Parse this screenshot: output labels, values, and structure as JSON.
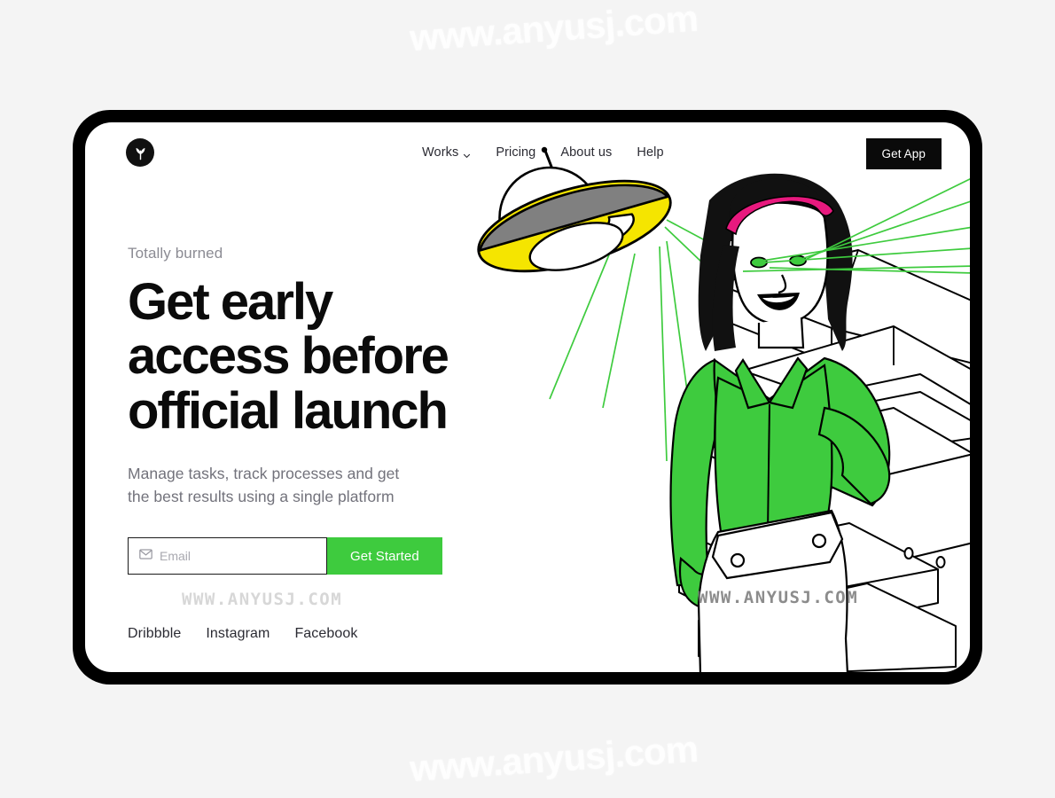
{
  "page": {
    "background_color": "#f4f4f4",
    "frame_color": "#000000",
    "screen_color": "#ffffff"
  },
  "watermarks": {
    "large": "www.anyusj.com",
    "pixel": "WWW.ANYUSJ.COM"
  },
  "header": {
    "logo_icon": "sprout-logo-icon",
    "nav": [
      {
        "label": "Works",
        "has_dropdown": true,
        "icon": "chevron-down-icon"
      },
      {
        "label": "Pricing",
        "has_dropdown": false
      },
      {
        "label": "About us",
        "has_dropdown": false
      },
      {
        "label": "Help",
        "has_dropdown": false
      }
    ],
    "cta": {
      "label": "Get App",
      "background": "#0a0a0a",
      "color": "#ffffff"
    }
  },
  "hero": {
    "eyebrow": "Totally burned",
    "headline_lines": [
      "Get early",
      "access before",
      "official launch"
    ],
    "headline": "Get early access before official launch",
    "subhead_lines": [
      "Manage tasks, track processes and get",
      "the best results using a single platform"
    ],
    "form": {
      "email_icon": "envelope-icon",
      "email_value": "",
      "email_placeholder": "Email",
      "submit_label": "Get Started",
      "submit_color": "#3ECB3E"
    }
  },
  "socials": [
    {
      "label": "Dribbble"
    },
    {
      "label": "Instagram"
    },
    {
      "label": "Facebook"
    }
  ],
  "illustration": {
    "name": "ufo-abducting-woman-at-printer",
    "ufo": {
      "body_color": "#F5E500",
      "top_band_color": "#808080",
      "dome_color": "#ffffff",
      "outline_color": "#000000",
      "beam_color": "#3ECB3E"
    },
    "character": {
      "hair_color": "#111111",
      "headband_color": "#E8197E",
      "shirt_color": "#3ECB3E",
      "eye_laser_color": "#3ECB3E",
      "skin_color": "#ffffff"
    },
    "machine": {
      "name": "office-printer-line-art",
      "fill": "#ffffff",
      "stroke": "#000000"
    }
  },
  "colors": {
    "accent_green": "#3ECB3E",
    "accent_yellow": "#F5E500",
    "accent_pink": "#E8197E",
    "text_dark": "#0b0b0b",
    "text_muted": "#72727b",
    "text_eyebrow": "#8b8b93"
  }
}
